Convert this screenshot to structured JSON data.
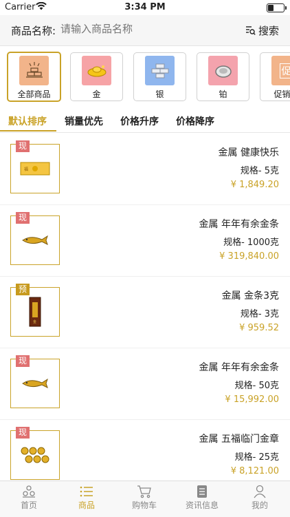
{
  "status_bar": {
    "carrier": "Carrier",
    "time": "3:34 PM"
  },
  "search": {
    "label": "商品名称:",
    "placeholder": "请输入商品名称",
    "button": "搜索"
  },
  "categories": [
    {
      "label": "全部商品",
      "icon": "all-goods-icon",
      "color": "#f2b48a",
      "active": true
    },
    {
      "label": "金",
      "icon": "gold-ingot-icon",
      "color": "#f6a3a6",
      "active": false
    },
    {
      "label": "银",
      "icon": "silver-bars-icon",
      "color": "#8fb6ee",
      "active": false
    },
    {
      "label": "铂",
      "icon": "platinum-ring-icon",
      "color": "#f4a3ad",
      "active": false
    },
    {
      "label": "促销商",
      "icon": "promotion-icon",
      "color": "#f2b48a",
      "active": false
    }
  ],
  "sort_tabs": [
    {
      "label": "默认排序",
      "active": true
    },
    {
      "label": "销量优先",
      "active": false
    },
    {
      "label": "价格升序",
      "active": false
    },
    {
      "label": "价格降序",
      "active": false
    }
  ],
  "products": [
    {
      "tag": "现",
      "tag_type": "xian",
      "name": "金属  健康快乐",
      "spec": "规格- 5克",
      "price": "¥ 1,849.20",
      "image": "gold-bar-card"
    },
    {
      "tag": "现",
      "tag_type": "xian",
      "name": "金属  年年有余金条",
      "spec": "规格- 1000克",
      "price": "¥ 319,840.00",
      "image": "gold-fish"
    },
    {
      "tag": "预",
      "tag_type": "yu",
      "name": "金属  金条3克",
      "spec": "规格- 3克",
      "price": "¥ 959.52",
      "image": "gold-bar-pack"
    },
    {
      "tag": "现",
      "tag_type": "xian",
      "name": "金属  年年有余金条",
      "spec": "规格- 50克",
      "price": "¥ 15,992.00",
      "image": "gold-fish"
    },
    {
      "tag": "现",
      "tag_type": "xian",
      "name": "金属  五福临门金章",
      "spec": "规格- 25克",
      "price": "¥ 8,121.00",
      "image": "gold-coins"
    }
  ],
  "tab_bar": [
    {
      "label": "首页",
      "icon": "home-icon",
      "active": false
    },
    {
      "label": "商品",
      "icon": "list-icon",
      "active": true
    },
    {
      "label": "购物车",
      "icon": "cart-icon",
      "active": false
    },
    {
      "label": "资讯信息",
      "icon": "news-icon",
      "active": false
    },
    {
      "label": "我的",
      "icon": "profile-icon",
      "active": false
    }
  ],
  "accent_color": "#c9a227"
}
